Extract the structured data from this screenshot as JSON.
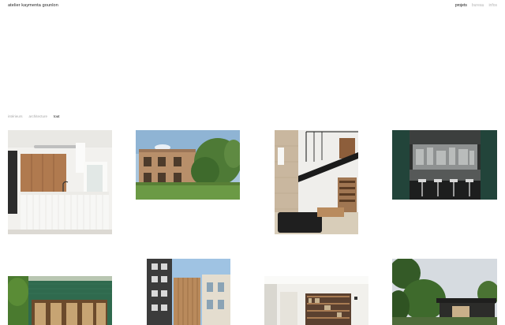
{
  "header": {
    "brand": "atelier kaymenta gounlon",
    "nav": [
      {
        "label": "projets",
        "active": true
      },
      {
        "label": "bureau",
        "active": false
      },
      {
        "label": "infos",
        "active": false
      }
    ]
  },
  "filters": [
    {
      "label": "intérieurs",
      "active": false
    },
    {
      "label": "architecture",
      "active": false
    },
    {
      "label": "tout",
      "active": true
    }
  ],
  "projects": [
    {
      "subject": "white-kitchen-wood-cabinets"
    },
    {
      "subject": "timber-house-garden"
    },
    {
      "subject": "loft-mezzanine-library"
    },
    {
      "subject": "dark-kitchen-bar-stools"
    },
    {
      "subject": "green-tiled-facade"
    },
    {
      "subject": "narrow-townhouse-facade"
    },
    {
      "subject": "bookshelf-living-room"
    },
    {
      "subject": "dark-house-in-trees"
    }
  ]
}
